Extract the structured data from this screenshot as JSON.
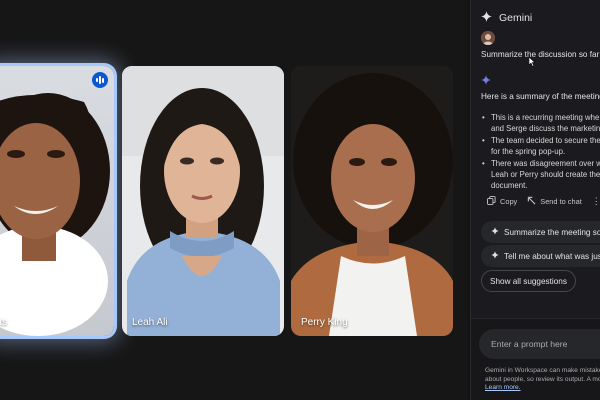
{
  "colors": {
    "accent": "#a8c7fa",
    "panel_bg": "#1b1b1f",
    "stage_bg": "#161616"
  },
  "tiles": [
    {
      "name": "rts",
      "speaking": true,
      "icon": "audio-level-icon"
    },
    {
      "name": "Leah Ali"
    },
    {
      "name": "Perry King"
    }
  ],
  "panel": {
    "title": "Gemini",
    "icon": "gemini-sparkle-icon",
    "user_prompt": "Summarize the discussion so far",
    "reply_intro": "Here is a summary of the meeting",
    "bullets": [
      "This is a recurring meeting whe",
      "and Serge discuss the marketin",
      "The team decided to secure the",
      "for the spring pop-up.",
      "There was disagreement over w",
      "Leah or Perry should create the",
      "document."
    ],
    "actions": {
      "copy": "Copy",
      "send_to_chat": "Send to chat"
    },
    "suggestions": [
      "Summarize the meeting so far",
      "Tell me about what was just"
    ],
    "show_all": "Show all suggestions",
    "prompt_placeholder": "Enter a prompt here",
    "disclaimer_line1": "Gemini in Workspace can make mistake",
    "disclaimer_line2": "about people, so review its output. A mo",
    "learn_more": "Learn more."
  }
}
